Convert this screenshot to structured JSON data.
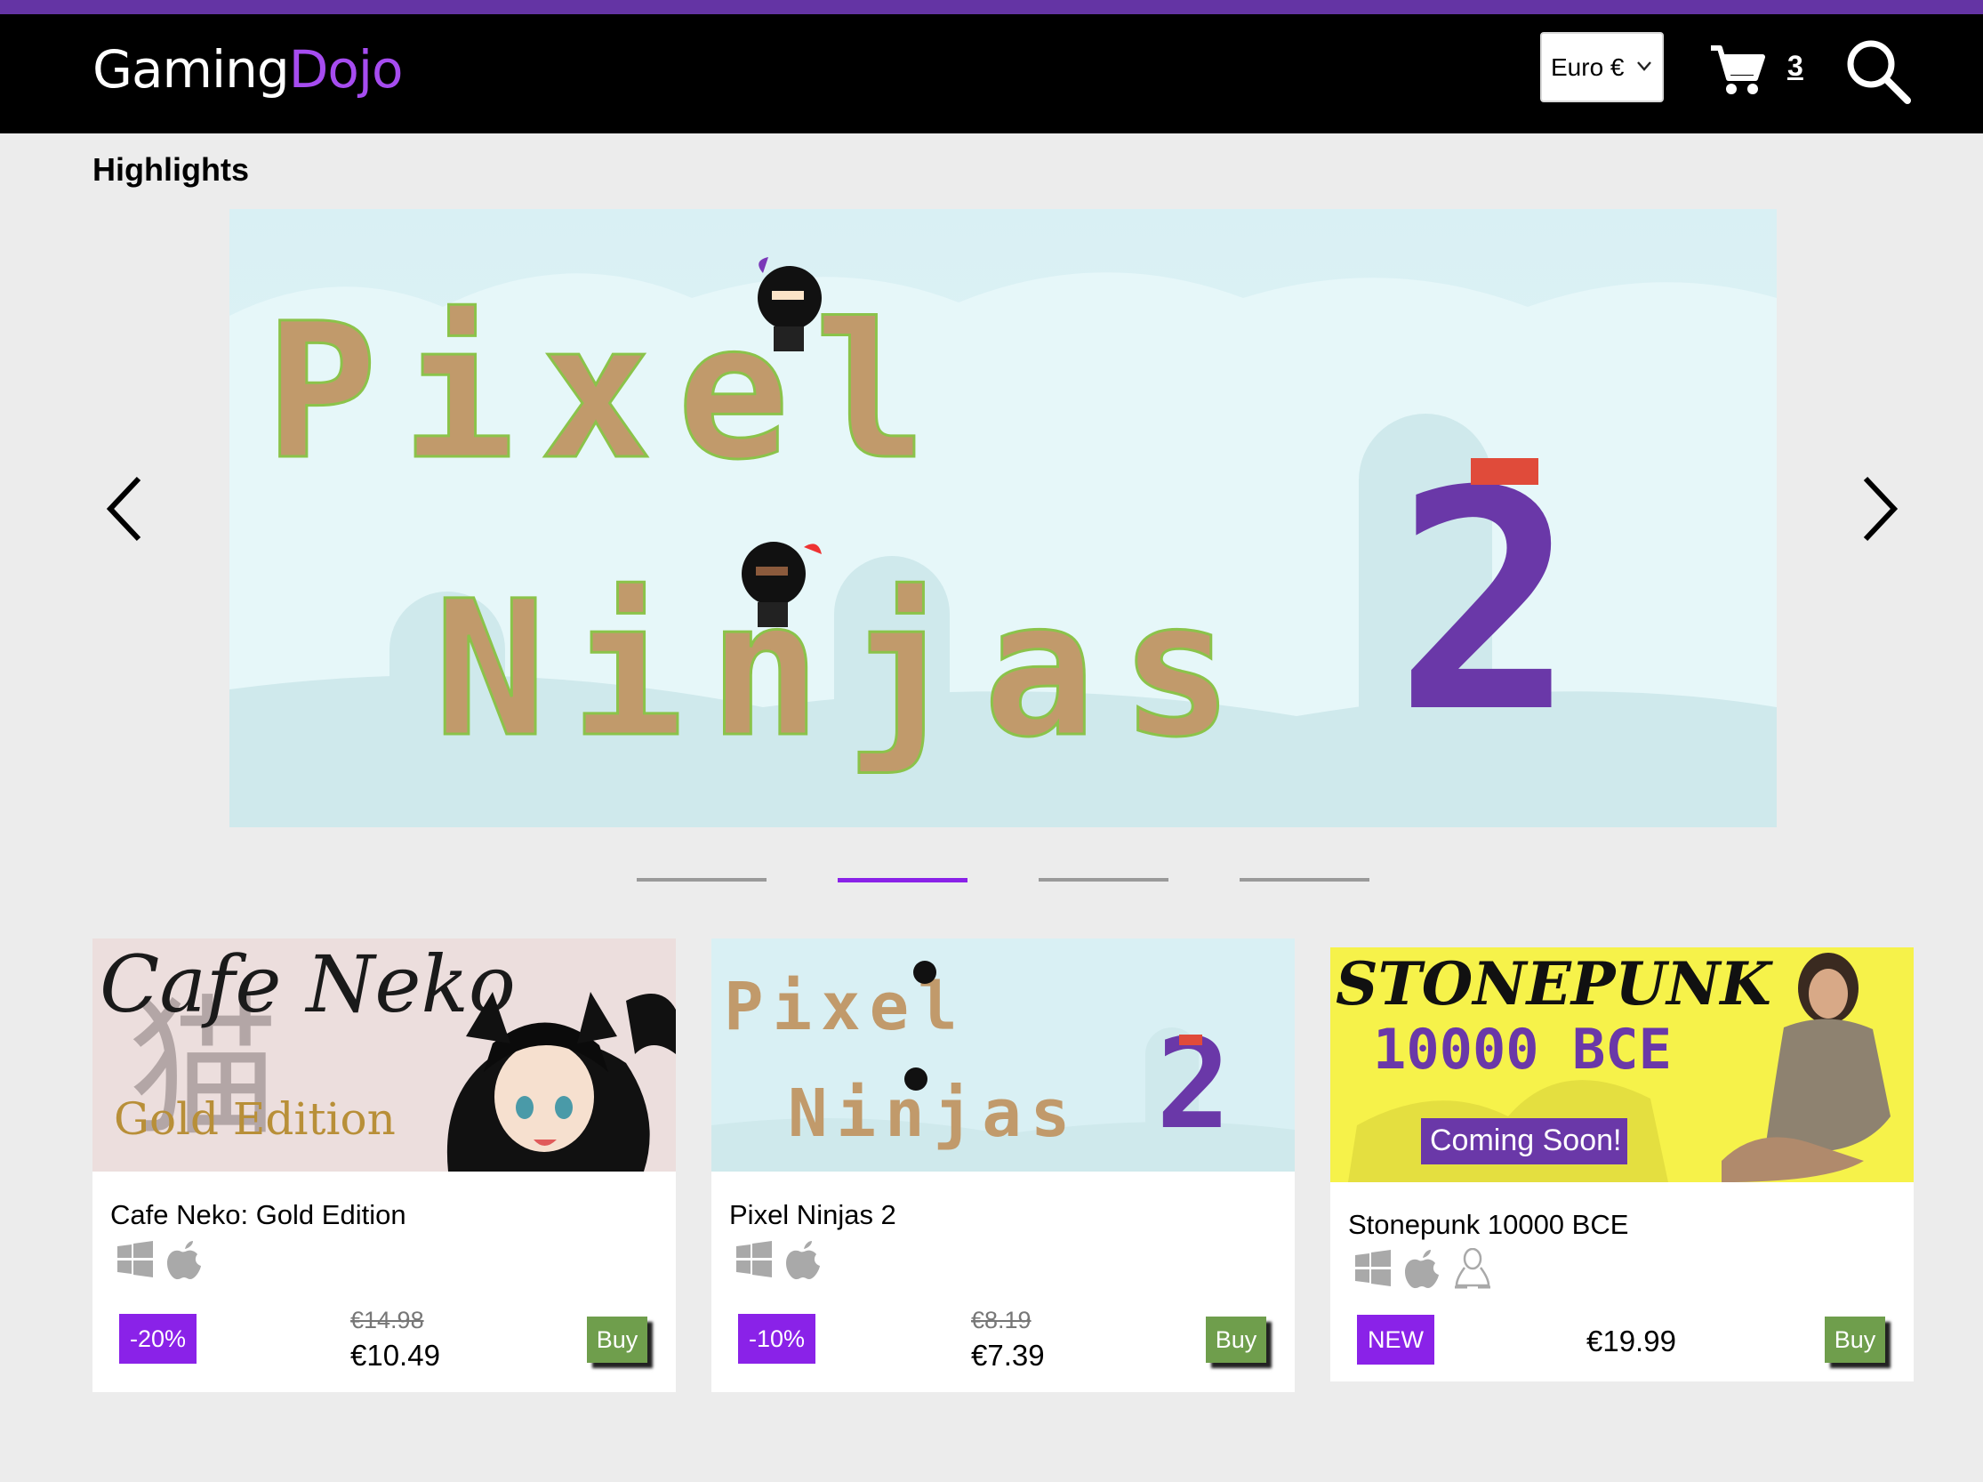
{
  "header": {
    "logo_primary": "Gaming",
    "logo_accent": "Dojo",
    "currency_selected": "Euro €",
    "cart_count": "3"
  },
  "highlights": {
    "title": "Highlights",
    "slide_text_line1": "Pixel",
    "slide_text_line2": "Ninjas",
    "slide_numeral": "2",
    "slide_count": 4,
    "active_slide": 2
  },
  "products": [
    {
      "banner_title": "Cafe Neko",
      "banner_kanji": "猫",
      "banner_subtitle": "Gold Edition",
      "name": "Cafe Neko: Gold Edition",
      "platforms": [
        "windows-icon",
        "apple-icon"
      ],
      "badge": "-20%",
      "old_price": "€14.98",
      "price": "€10.49",
      "buy_label": "Buy"
    },
    {
      "banner_title": "Pixel",
      "banner_title2": "Ninjas",
      "banner_numeral": "2",
      "name": "Pixel Ninjas 2",
      "platforms": [
        "windows-icon",
        "apple-icon"
      ],
      "badge": "-10%",
      "old_price": "€8.19",
      "price": "€7.39",
      "buy_label": "Buy"
    },
    {
      "banner_title": "STONEPUNK",
      "banner_subtitle": "10000 BCE",
      "banner_tag": "Coming Soon!",
      "name": "Stonepunk 10000 BCE",
      "platforms": [
        "windows-icon",
        "apple-icon",
        "linux-icon"
      ],
      "badge": "NEW",
      "price": "€19.99",
      "buy_label": "Buy"
    }
  ],
  "colors": {
    "brand_purple": "#8a22e8",
    "header_stripe": "#6434a4",
    "buy_green": "#6f9e4c",
    "hero_dirt": "#c19a6b",
    "hero_numeral": "#6a38a8"
  }
}
